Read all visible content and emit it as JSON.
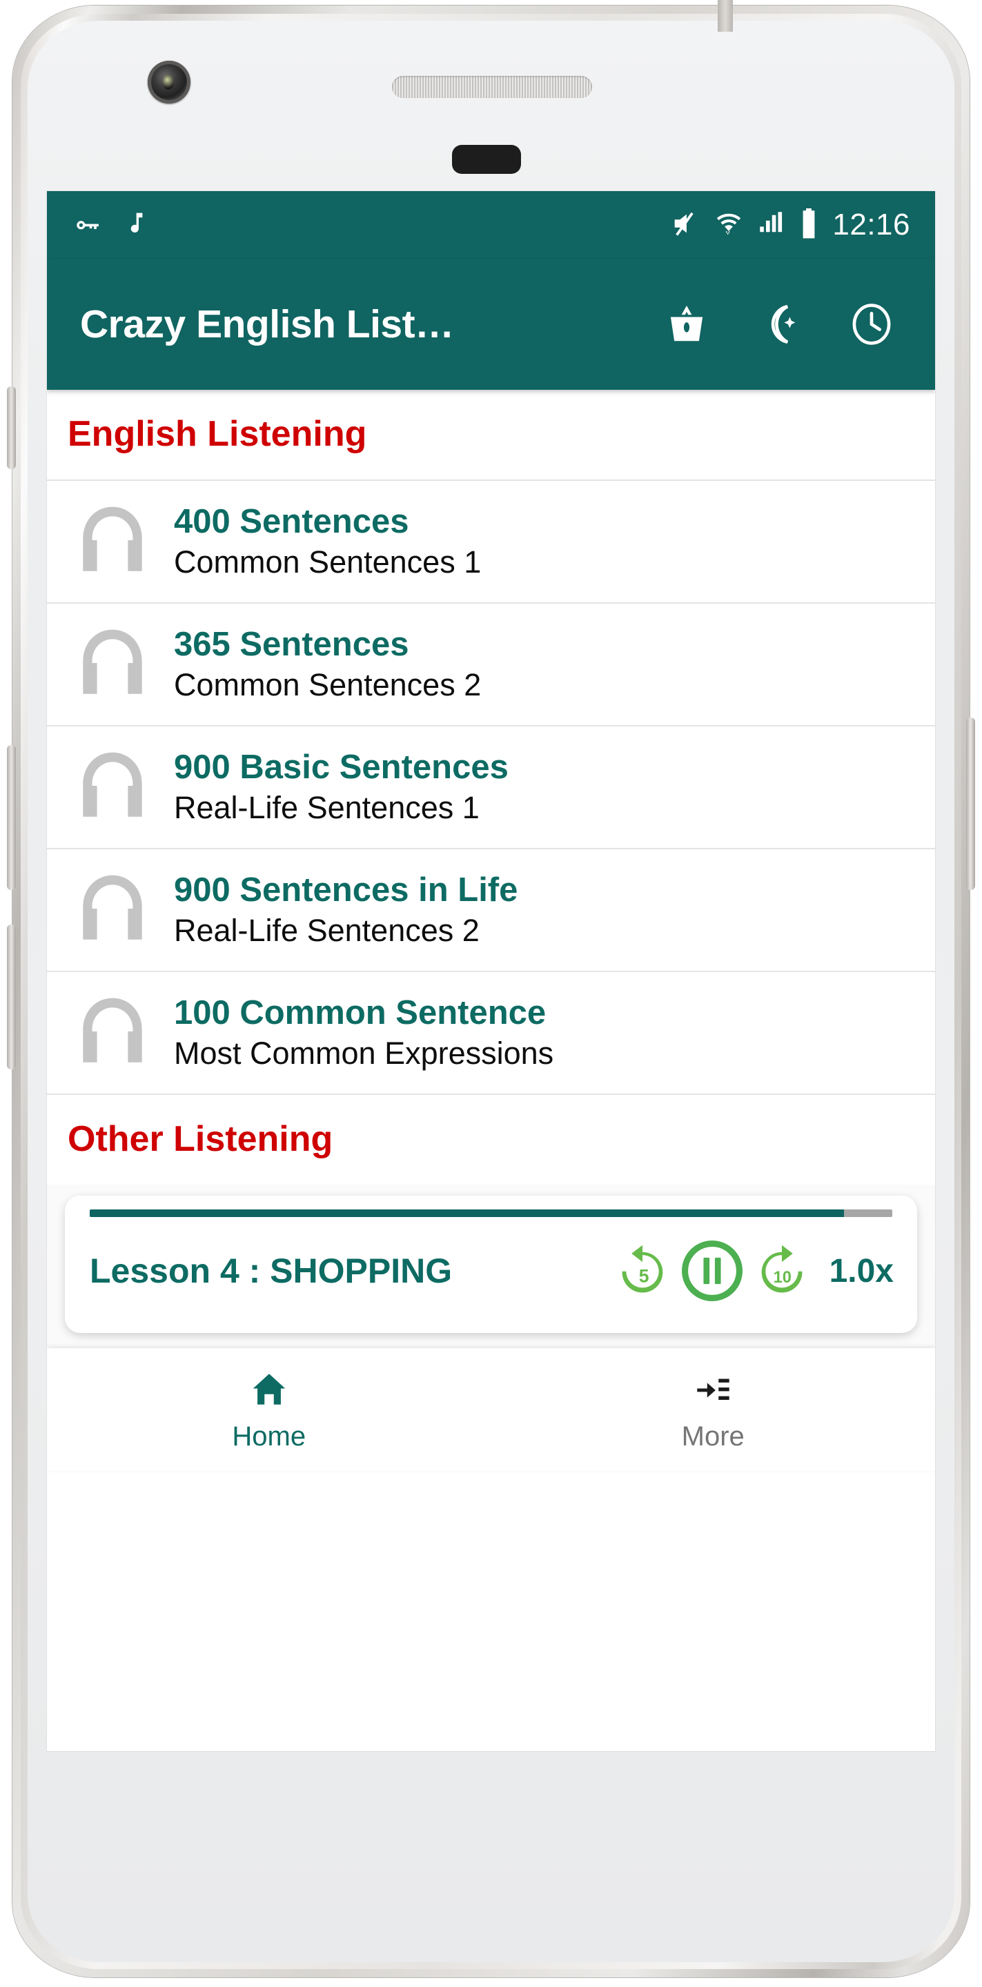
{
  "colors": {
    "primary_teal": "#106461",
    "title_teal": "#0d6b63",
    "heading_red": "#cf0000",
    "player_green": "#4caf50",
    "screen_bg": "#fafafa",
    "inactive_gray": "#757575"
  },
  "status_bar": {
    "left_icons": [
      "key-icon",
      "music-note-icon"
    ],
    "right_icons": [
      "volume-mute-icon",
      "wifi-icon",
      "cellular-signal-icon",
      "battery-full-icon"
    ],
    "clock": "12:16"
  },
  "app_bar": {
    "title": "Crazy English List…",
    "actions": [
      {
        "name": "shopping-basket-icon"
      },
      {
        "name": "dark-mode-moon-icon"
      },
      {
        "name": "history-clock-icon"
      }
    ]
  },
  "sections": [
    {
      "heading": "English Listening",
      "items": [
        {
          "icon": "headphones-icon",
          "title": "400 Sentences",
          "subtitle": "Common Sentences 1"
        },
        {
          "icon": "headphones-icon",
          "title": "365 Sentences",
          "subtitle": "Common Sentences 2"
        },
        {
          "icon": "headphones-icon",
          "title": "900 Basic Sentences",
          "subtitle": "Real-Life Sentences 1"
        },
        {
          "icon": "headphones-icon",
          "title": "900 Sentences in Life",
          "subtitle": "Real-Life Sentences 2"
        },
        {
          "icon": "headphones-icon",
          "title": "100 Common Sentence",
          "subtitle": "Most Common Expressions"
        }
      ]
    },
    {
      "heading": "Other Listening",
      "items": []
    }
  ],
  "player": {
    "track_title": "Lesson 4 : SHOPPING",
    "progress_percent": 94,
    "rewind_seconds": "5",
    "forward_seconds": "10",
    "state": "playing",
    "pause_icon": "pause-icon",
    "rewind_icon": "replay-5-icon",
    "forward_icon": "forward-10-icon",
    "speed": "1.0x"
  },
  "bottom_nav": [
    {
      "icon": "home-icon",
      "label": "Home",
      "active": true
    },
    {
      "icon": "playlist-add-icon",
      "label": "More",
      "active": false
    }
  ]
}
